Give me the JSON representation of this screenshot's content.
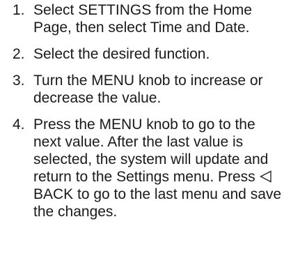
{
  "steps": [
    {
      "number": "1.",
      "text": "Select SETTINGS from the Home Page, then select Time and Date."
    },
    {
      "number": "2.",
      "text": "Select the desired function."
    },
    {
      "number": "3.",
      "text": "Turn the MENU knob to increase or decrease the value."
    },
    {
      "number": "4.",
      "text_before": "Press the MENU knob to go to the next value. After the last value is selected, the system will update and return to the Settings menu. Press",
      "icon": "back-triangle-icon",
      "text_after": "BACK to go to the last menu and save the changes."
    }
  ],
  "colors": {
    "text": "#1a1a1a",
    "background": "#ffffff"
  }
}
